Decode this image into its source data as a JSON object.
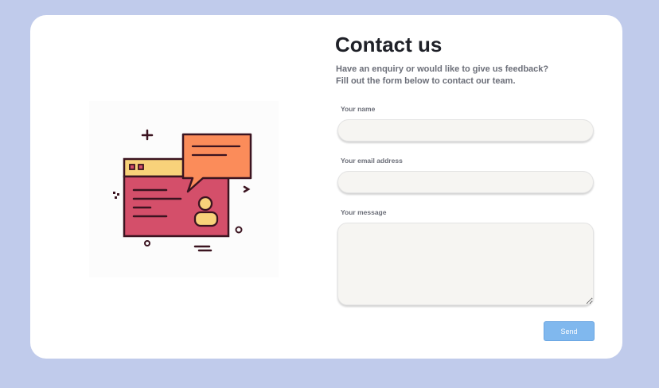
{
  "header": {
    "title": "Contact us",
    "subtitle_line1": "Have an enquiry or would like to give us feedback?",
    "subtitle_line2": "Fill out the form below to contact our team."
  },
  "form": {
    "name_label": "Your name",
    "name_value": "",
    "email_label": "Your email address",
    "email_value": "",
    "message_label": "Your message",
    "message_value": "",
    "send_label": "Send"
  },
  "colors": {
    "page_background": "#c0cbeb",
    "card_background": "#ffffff",
    "send_button": "#80b8ee",
    "illustration_window": "#d44f6a",
    "illustration_bubble": "#fb8c5a",
    "illustration_titlebar": "#f8d27a"
  },
  "illustration": {
    "icon_name": "contact-window-with-chat-bubble-icon"
  }
}
